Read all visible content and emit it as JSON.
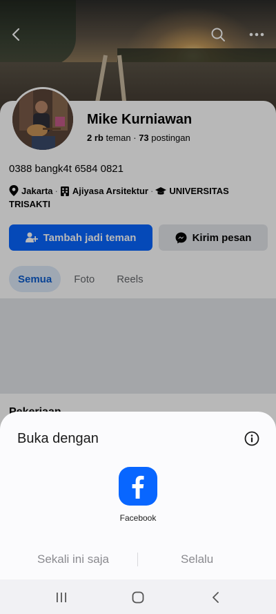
{
  "profile": {
    "name": "Mike Kurniawan",
    "friends_count": "2 rb",
    "friends_label": "teman",
    "stats_sep": "·",
    "posts_count": "73",
    "posts_label": "postingan",
    "phone_bio": "0388 bangk4t 6584 0821",
    "location": "Jakarta",
    "work": "Ajiyasa Arsitektur",
    "education": "UNIVERSITAS TRISAKTI",
    "info_sep": "·"
  },
  "actions": {
    "add_friend_label": "Tambah jadi teman",
    "message_label": "Kirim pesan"
  },
  "tabs": [
    {
      "label": "Semua",
      "active": true
    },
    {
      "label": "Foto",
      "active": false
    },
    {
      "label": "Reels",
      "active": false
    }
  ],
  "section_peek": "Pekerjaan",
  "open_with_sheet": {
    "title": "Buka dengan",
    "app_name": "Facebook",
    "just_once_label": "Sekali ini saja",
    "always_label": "Selalu"
  },
  "colors": {
    "accent": "#0866ff",
    "tab_active_bg": "#dde9f8",
    "tab_active_text": "#0d5ecf"
  },
  "icons": {
    "back": "chevron-left-icon",
    "search": "search-icon",
    "more": "more-horizontal-icon",
    "location": "map-pin-icon",
    "work": "building-icon",
    "education": "graduation-cap-icon",
    "add_friend": "person-add-icon",
    "messenger": "messenger-icon",
    "info": "info-icon",
    "app": "facebook-icon"
  }
}
